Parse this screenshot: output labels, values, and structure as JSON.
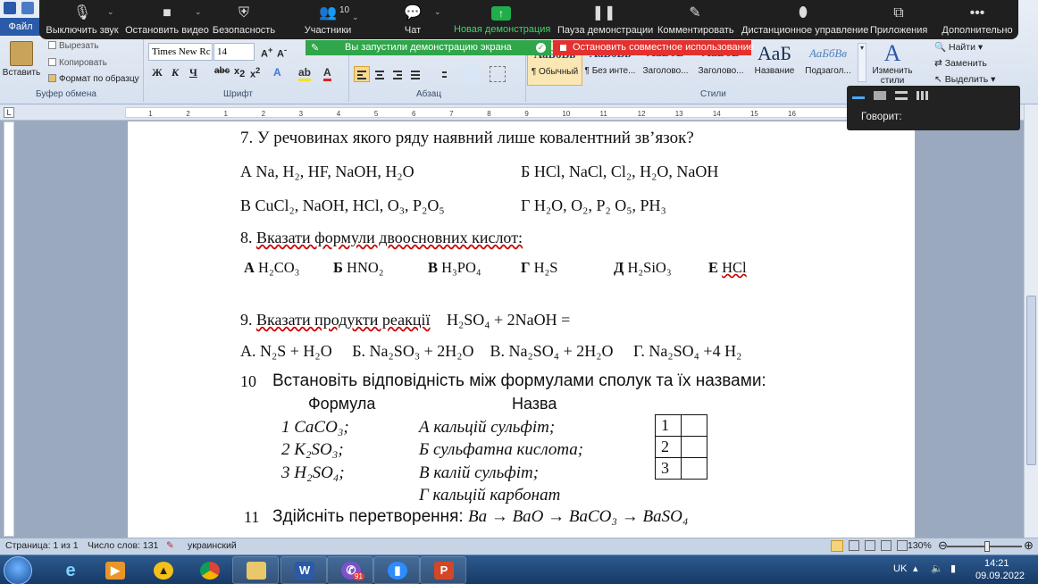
{
  "ribbon": {
    "file_tab": "Файл",
    "clipboard": {
      "paste": "Вставить",
      "cut": "Вырезать",
      "copy": "Копировать",
      "format_painter": "Формат по образцу",
      "group_label": "Буфер обмена"
    },
    "font": {
      "name": "Times New Rc",
      "size": "14",
      "group_label": "Шрифт",
      "bold": "Ж",
      "italic": "К",
      "underline": "Ч"
    },
    "paragraph": {
      "group_label": "Абзац"
    },
    "styles": {
      "group_label": "Стили",
      "items": [
        {
          "sample": "АаБбВв",
          "name": "¶ Обычный"
        },
        {
          "sample": "АаБбВв",
          "name": "¶ Без инте..."
        },
        {
          "sample": "АаБбВ",
          "name": "Заголово..."
        },
        {
          "sample": "АаБбВ",
          "name": "Заголово..."
        },
        {
          "sample": "АаБ",
          "name": "Название"
        },
        {
          "sample": "АаБбВв",
          "name": "Подзагол..."
        }
      ],
      "change_styles": "Изменить стили"
    },
    "editing": {
      "find": "Найти",
      "replace": "Заменить",
      "select": "Выделить"
    }
  },
  "zoom": {
    "buttons": [
      {
        "label": "Выключить звук",
        "icon": "microphone-icon"
      },
      {
        "label": "Остановить видео",
        "icon": "camera-icon"
      },
      {
        "label": "Безопасность",
        "icon": "shield-icon"
      },
      {
        "label": "Участники",
        "icon": "participants-icon",
        "count": "10"
      },
      {
        "label": "Чат",
        "icon": "chat-icon"
      },
      {
        "label": "Новая демонстрация",
        "icon": "share-up-arrow-icon"
      },
      {
        "label": "Пауза демонстрации",
        "icon": "pause-icon"
      },
      {
        "label": "Комментировать",
        "icon": "pen-icon"
      },
      {
        "label": "Дистанционное управление",
        "icon": "mouse-icon"
      },
      {
        "label": "Приложения",
        "icon": "apps-icon"
      },
      {
        "label": "Дополнительно",
        "icon": "more-icon"
      }
    ],
    "share_banner": "Вы запустили демонстрацию экрана",
    "stop_share": "Остановить совместное использование",
    "speaker_label": "Говорит:"
  },
  "ruler": {
    "ticks": [
      "1",
      "2",
      "1",
      "2",
      "3",
      "4",
      "5",
      "6",
      "7",
      "8",
      "9",
      "10",
      "11",
      "12",
      "13",
      "14",
      "15",
      "16"
    ]
  },
  "document": {
    "q7": {
      "text": "7. У речовинах якого ряду наявний лише ковалентний зв’язок?",
      "a": "А  Na, H₂, HF, NaOH, H₂O",
      "b": "Б HCl, NaCl, Cl₂, H₂O, NaOH",
      "v": "В CuCl₂, NaOH, HCl, O₃, P₂O₅",
      "g": "Г H₂O, O₂, P₂ O₅, PH₃"
    },
    "q8": {
      "num": "8.",
      "text": "Вказати формули двоосновних кислот:",
      "options": [
        {
          "letter": "А",
          "formula": "H₂CO₃"
        },
        {
          "letter": "Б",
          "formula": "HNO₂"
        },
        {
          "letter": "В",
          "formula": "H₃PO₄"
        },
        {
          "letter": "Г",
          "formula": "H₂S"
        },
        {
          "letter": "Д",
          "formula": "H₂SiO₃"
        },
        {
          "letter": "Е",
          "formula": "HCl"
        }
      ]
    },
    "q9": {
      "num": "9.",
      "text": "Вказати продукти реакції",
      "equation": "H₂SO₄ + 2NaOH =",
      "answers": "А. N₂S + H₂O     Б. Na₂SO₃ + 2H₂O    В. Na₂SO₄ + 2H₂O     Г. Na₂SO₄ +4 H₂"
    },
    "q10": {
      "num": "10",
      "text": "Встановіть відповідність між формулами сполук та їх назвами:",
      "col_formula": "Формула",
      "col_name": "Назва",
      "formulas": [
        "1 CaCO₃;",
        "2 K₂SO₃;",
        "3 H₂SO₄;"
      ],
      "names": [
        "А кальцій сульфіт;",
        "Б сульфатна кислота;",
        "В калій сульфіт;",
        "Г кальцій карбонат"
      ],
      "grid": [
        "1",
        "2",
        "3"
      ]
    },
    "q11": {
      "num": "11",
      "text": "Здійсніть перетворення:",
      "chain": "Ba → BaO → BaCO₃ → BaSO₄"
    }
  },
  "status": {
    "page": "Страница: 1 из 1",
    "words": "Число слов: 131",
    "language": "украинский",
    "zoom": "130%"
  },
  "taskbar": {
    "lang": "UK",
    "time": "14:21",
    "date": "09.09.2022",
    "viber_badge": "91"
  }
}
